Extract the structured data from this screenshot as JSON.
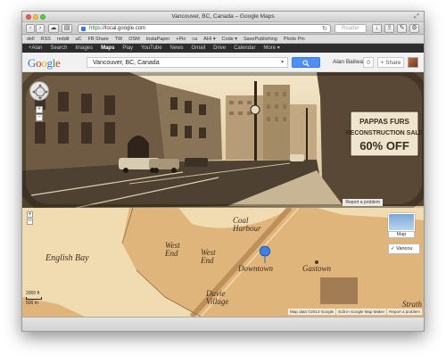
{
  "window": {
    "title": "Vancouver, BC, Canada – Google Maps"
  },
  "toolbar": {
    "url_scheme": "https",
    "url_host": "local.google.com",
    "reader_label": "Reader"
  },
  "bookmarks": [
    "dell",
    "RSS",
    "reddit",
    "uC",
    "FB Share",
    "TW",
    "OSM",
    "InstaPaper",
    "+Pin",
    "ca",
    "AHI ▾",
    "Code ▾",
    "SavePublishing",
    "Photo Pin"
  ],
  "gbar": {
    "items": [
      "+Alan",
      "Search",
      "Images",
      "Maps",
      "Play",
      "YouTube",
      "News",
      "Gmail",
      "Drive",
      "Calendar",
      "More ▾"
    ],
    "active": "Maps"
  },
  "header": {
    "logo_letters": [
      "G",
      "o",
      "o",
      "g",
      "l",
      "e"
    ],
    "search_value": "Vancouver, BC, Canada",
    "user_name": "Alan Bailward",
    "notifications": "0",
    "share_label": "+ Share"
  },
  "streetview": {
    "sign_line1": "PAPPAS FURS",
    "sign_line2": "RECONSTRUCTION SALE",
    "sign_line3": "60% OFF",
    "report_label": "Report a problem"
  },
  "map": {
    "labels": {
      "english_bay": "English Bay",
      "west_end_1": "West\nEnd",
      "west_end_2": "West\nEnd",
      "coal_harbour": "Coal\nHarbour",
      "downtown": "Downtown",
      "gastown": "Gastown",
      "davie_village": "Davie\nVillage",
      "strath": "Strath"
    },
    "map_type_label": "Map",
    "layer_label": "✓ Vancou",
    "scale_ft": "2000 ft",
    "scale_m": "500 m",
    "attribution": [
      "Map data ©2013 Google",
      "Edit in Google Map Maker",
      "Report a problem"
    ]
  },
  "colors": {
    "sepia_land": "#e0b57c",
    "sepia_water": "#f1dcb2",
    "gbar": "#2d2d2d",
    "search_blue": "#4d8ff5"
  }
}
